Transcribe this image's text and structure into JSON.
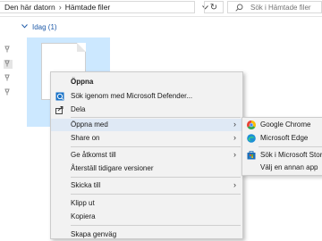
{
  "address": {
    "crumbs": [
      "Den här datorn",
      "Hämtade filer"
    ],
    "separator": "›",
    "dropdown_icon": "chevron-down-icon",
    "refresh_glyph": "↻"
  },
  "search": {
    "placeholder": "Sök i Hämtade filer"
  },
  "group": {
    "label": "Idag (1)"
  },
  "menu": {
    "items": [
      {
        "label": "Öppna",
        "icon": "blank",
        "bold": true
      },
      {
        "label": "Sök igenom med Microsoft Defender...",
        "icon": "defender-shield-icon"
      },
      {
        "label": "Dela",
        "icon": "share-icon"
      },
      {
        "label": "Öppna med",
        "icon": "blank",
        "arrow": "›"
      },
      {
        "label": "Share on",
        "icon": "blank",
        "arrow": "›"
      },
      {
        "label": "Ge åtkomst till",
        "icon": "blank",
        "arrow": "›"
      },
      {
        "label": "Återställ tidigare versioner",
        "icon": "blank"
      },
      {
        "label": "Skicka till",
        "icon": "blank",
        "arrow": "›"
      },
      {
        "label": "Klipp ut",
        "icon": "blank"
      },
      {
        "label": "Kopiera",
        "icon": "blank"
      },
      {
        "label": "Skapa genväg",
        "icon": "blank"
      }
    ]
  },
  "submenu": {
    "items": [
      {
        "label": "Google Chrome",
        "icon": "chrome-icon"
      },
      {
        "label": "Microsoft Edge",
        "icon": "edge-icon"
      },
      {
        "label": "Sök i Microsoft Store",
        "icon": "store-icon"
      },
      {
        "label": "Välj en annan app",
        "icon": "blank"
      }
    ]
  },
  "colors": {
    "accent": "#1e5aa8",
    "selection": "#cce8ff",
    "pdf_red": "#d11b1b",
    "menu_bg": "#f2f2f2"
  }
}
